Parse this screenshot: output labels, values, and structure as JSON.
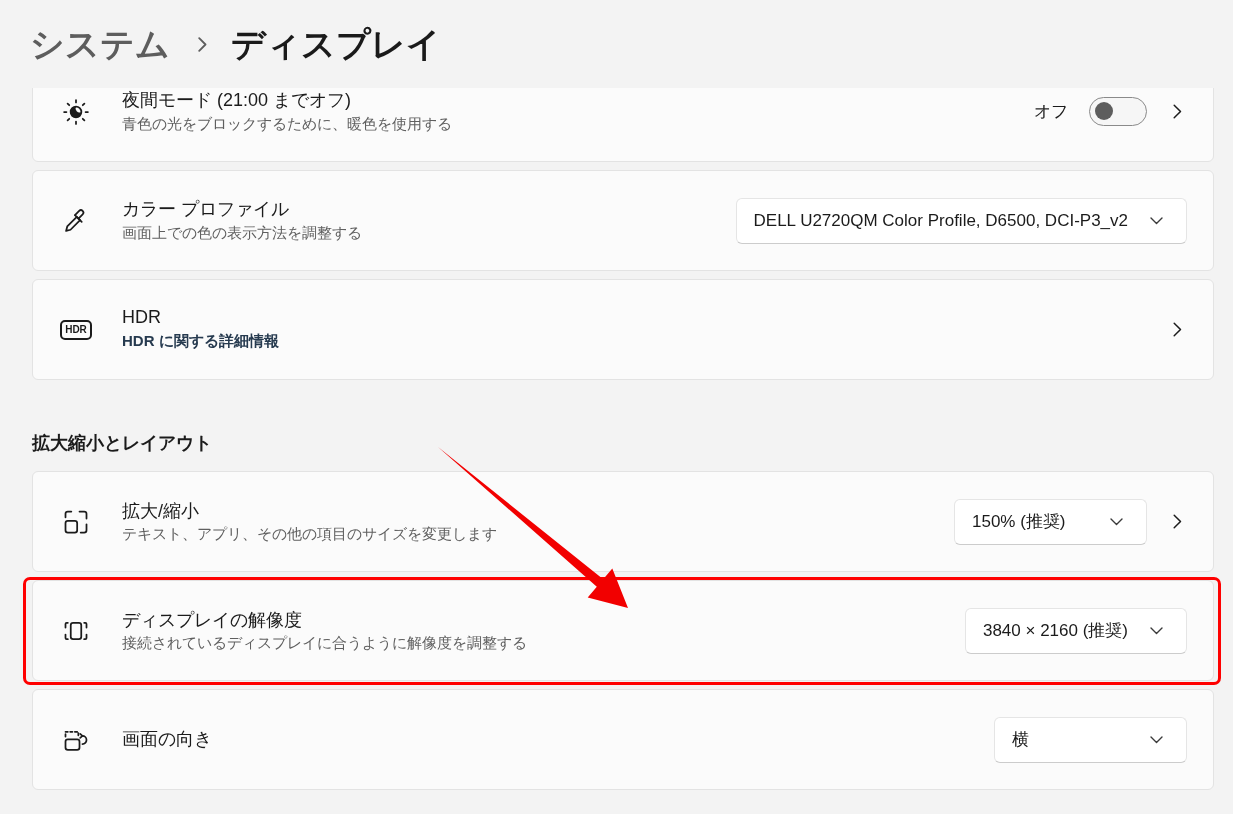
{
  "breadcrumb": [
    {
      "label": "システム",
      "current": false
    },
    {
      "label": "ディスプレイ",
      "current": true
    }
  ],
  "sections": [
    {
      "items": [
        {
          "kind": "toggle",
          "title": "夜間モード (21:00 までオフ)",
          "description": "青色の光をブロックするために、暖色を使用する",
          "state_label": "オフ",
          "on": false,
          "chevron": true,
          "highlighted": false
        },
        {
          "kind": "dropdown",
          "title": "カラー プロファイル",
          "description": "画面上での色の表示方法を調整する",
          "value": "DELL U2720QM Color Profile, D6500, DCI-P3_v2",
          "chevron": false,
          "highlighted": false
        },
        {
          "kind": "link",
          "icon_text": "HDR",
          "title": "HDR",
          "link": "HDR に関する詳細情報",
          "chevron": true,
          "highlighted": false
        }
      ]
    },
    {
      "heading": "拡大縮小とレイアウト",
      "items": [
        {
          "kind": "dropdown",
          "title": "拡大/縮小",
          "description": "テキスト、アプリ、その他の項目のサイズを変更します",
          "value": "150% (推奨)",
          "chevron": true,
          "highlighted": false
        },
        {
          "kind": "dropdown",
          "title": "ディスプレイの解像度",
          "description": "接続されているディスプレイに合うように解像度を調整する",
          "value": "3840 × 2160 (推奨)",
          "chevron": false,
          "highlighted": true
        },
        {
          "kind": "dropdown",
          "title": "画面の向き",
          "value": "横",
          "chevron": false,
          "highlighted": false
        }
      ]
    }
  ]
}
